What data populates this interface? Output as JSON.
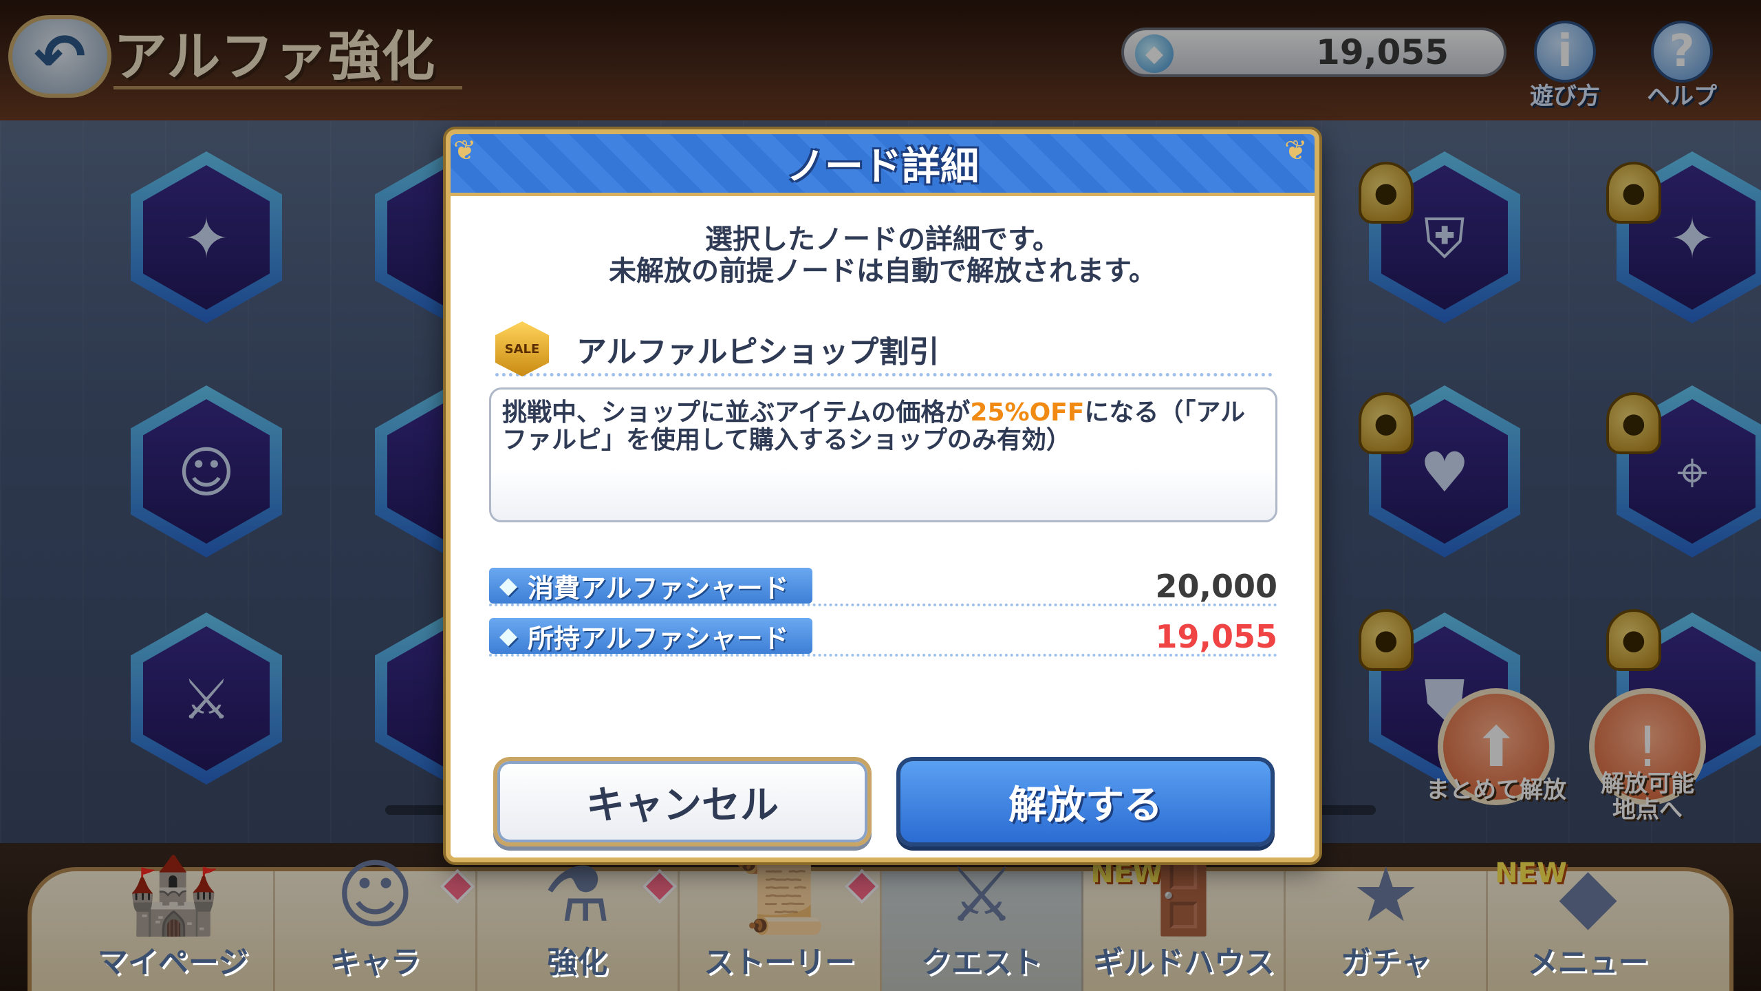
{
  "screen": {
    "title": "アルファ強化",
    "currency_value": "19,055",
    "help_howto_label": "遊び方",
    "help_label": "ヘルプ"
  },
  "side_actions": {
    "bulk_unlock_label": "まとめて解放",
    "goto_unlockable_label": "解放可能\n地点へ"
  },
  "dialog": {
    "title": "ノード詳細",
    "description_line1": "選択したノードの詳細です。",
    "description_line2": "未解放の前提ノードは自動で解放されます。",
    "node_name": "アルファルピショップ割引",
    "node_icon_text": "SALE",
    "effect_text_before": "挑戦中、ショップに並ぶアイテムの価格が",
    "effect_highlight": "25%OFF",
    "effect_text_after": "になる（「アルファルピ」を使用して購入するショップのみ有効）",
    "cost_label": "消費アルファシャード",
    "cost_value": "20,000",
    "owned_label": "所持アルファシャード",
    "owned_value": "19,055",
    "cancel_label": "キャンセル",
    "unlock_label": "解放する"
  },
  "bottom_nav": [
    {
      "label": "マイページ",
      "icon": "castle-icon"
    },
    {
      "label": "キャラ",
      "icon": "character-icon"
    },
    {
      "label": "強化",
      "icon": "potion-icon"
    },
    {
      "label": "ストーリー",
      "icon": "scroll-icon"
    },
    {
      "label": "クエスト",
      "icon": "swords-icon",
      "active": true
    },
    {
      "label": "ギルドハウス",
      "icon": "door-icon",
      "tag": "NEW"
    },
    {
      "label": "ガチャ",
      "icon": "gacha-icon"
    },
    {
      "label": "メニュー",
      "icon": "crystal-icon",
      "tag": "NEW"
    }
  ],
  "colors": {
    "accent_blue": "#3f82e0",
    "gold_border": "#d7b15e",
    "highlight_orange": "#f08a12",
    "insufficient_red": "#f04444"
  }
}
